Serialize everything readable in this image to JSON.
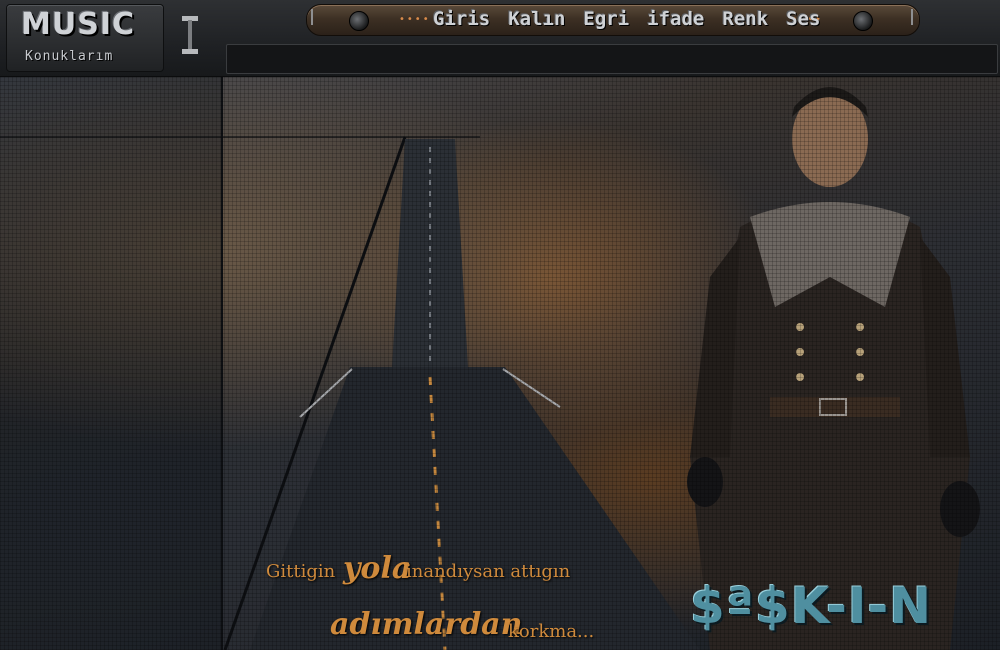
{
  "logo": {
    "title": "MUSIC",
    "subtitle": "Konuklarım"
  },
  "menu": {
    "items": [
      "Giris",
      "Kalın",
      "Egri",
      "ifade",
      "Renk",
      "Ses"
    ],
    "left_dots": "••••",
    "right_dots": "••••"
  },
  "quote": {
    "line1_a": "Gittigin",
    "line1_b": "yola",
    "line1_c": "inandıysan attıgın",
    "line2_a": "adımlardan",
    "line2_b": "korkma..."
  },
  "signature": "$ª$K-I-N",
  "colors": {
    "accent": "#cf8a3c",
    "signature": "#4f8fa0",
    "menu_bg": "#3d3024"
  },
  "icons": {
    "menu_toggle": "caret-icon",
    "knobs": "knob-icon"
  }
}
